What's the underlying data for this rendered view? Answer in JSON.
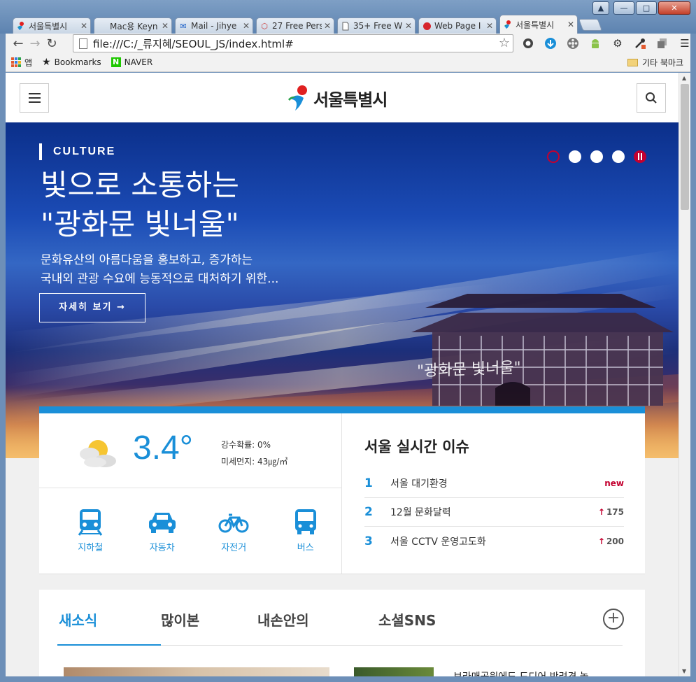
{
  "browser": {
    "tabs": [
      {
        "label": "서울특별시",
        "icon": "seoul-logo-icon"
      },
      {
        "label": "Mac용 Keyn",
        "icon": "apple-icon"
      },
      {
        "label": "Mail - Jihye",
        "icon": "mail-icon"
      },
      {
        "label": "27 Free Pers",
        "icon": "cube-icon"
      },
      {
        "label": "35+ Free W",
        "icon": "document-icon"
      },
      {
        "label": "Web Page I",
        "icon": "red-blob-icon"
      },
      {
        "label": "서울특별시",
        "icon": "seoul-logo-icon",
        "active": true
      }
    ],
    "address": "file:///C:/_류지혜/SEOUL_JS/index.html#",
    "bookmarks": {
      "apps_label": "앱",
      "bookmarks_label": "Bookmarks",
      "naver_label": "NAVER",
      "other_label": "기타 북마크"
    }
  },
  "site": {
    "logo_text": "서울특별시",
    "hero": {
      "category": "CULTURE",
      "title_line1": "빛으로 소통하는",
      "title_line2": "\"광화문 빛너울\"",
      "desc_line1": "문화유산의 아름다움을 홍보하고, 증가하는",
      "desc_line2": "국내외 관광 수요에 능동적으로 대처하기 위한...",
      "more_label": "자세히 보기 →",
      "gate_sign": "\"광화문 빛너울\"",
      "slides": 4
    },
    "weather": {
      "temperature": "3.4°",
      "rain_label": "강수확률: 0%",
      "dust_label": "미세먼지: 43㎍/㎥"
    },
    "transport": [
      {
        "label": "지하철",
        "icon": "subway-icon"
      },
      {
        "label": "자동차",
        "icon": "car-icon"
      },
      {
        "label": "자전거",
        "icon": "bicycle-icon"
      },
      {
        "label": "버스",
        "icon": "bus-icon"
      }
    ],
    "issues": {
      "title": "서울 실시간 이슈",
      "items": [
        {
          "rank": "1",
          "text": "서울 대기환경",
          "badge": "new"
        },
        {
          "rank": "2",
          "text": "12월 문화달력",
          "count": "175"
        },
        {
          "rank": "3",
          "text": "서울 CCTV 운영고도화",
          "count": "200"
        }
      ]
    },
    "news": {
      "tabs": [
        "새소식",
        "많이본",
        "내손안의",
        "소셜SNS"
      ],
      "active_tab": 0,
      "headline": "보라매공원에도 드디어 반려견 놀"
    },
    "colors": {
      "accent": "#1a8fd8",
      "highlight": "#c3002f"
    }
  }
}
